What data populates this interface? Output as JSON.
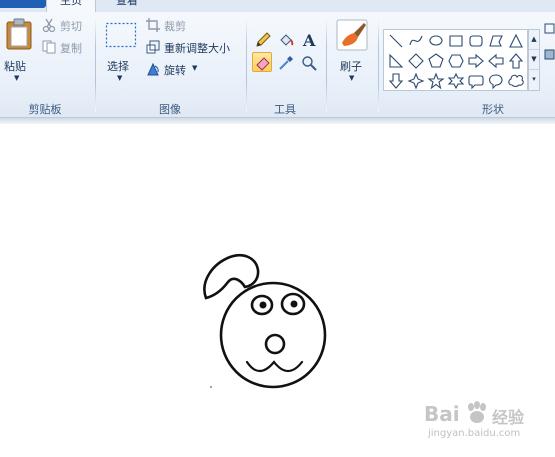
{
  "tabs": {
    "home": "主页",
    "view": "查看"
  },
  "clipboard": {
    "paste": "粘贴",
    "cut": "剪切",
    "copy": "复制",
    "group": "剪贴板"
  },
  "image": {
    "select": "选择",
    "crop": "裁剪",
    "resize": "重新调整大小",
    "rotate": "旋转",
    "group": "图像"
  },
  "tools": {
    "group": "工具",
    "items": [
      "pencil-icon",
      "fill-bucket-icon",
      "text-icon",
      "eraser-icon",
      "color-picker-icon",
      "magnifier-icon"
    ],
    "active": "eraser-icon"
  },
  "brushes": {
    "label": "刷子"
  },
  "shapes": {
    "group": "形状",
    "items": [
      "line",
      "curve",
      "oval",
      "rectangle",
      "rounded-rectangle",
      "polygon",
      "triangle",
      "right-triangle",
      "diamond",
      "pentagon",
      "hexagon",
      "right-arrow",
      "left-arrow",
      "up-arrow",
      "down-arrow",
      "four-point-star",
      "five-point-star",
      "six-point-star",
      "rounded-callout",
      "oval-callout",
      "cloud-callout"
    ]
  },
  "watermark": {
    "brand_left": "Bai",
    "brand_right": "经验",
    "url": "jingyan.baidu.com"
  },
  "colors": {
    "ribbon": "#e6eef8",
    "file_tab": "#1f5fb4",
    "active_tool": "#ffcf5a",
    "drawing_stroke": "#111111"
  }
}
